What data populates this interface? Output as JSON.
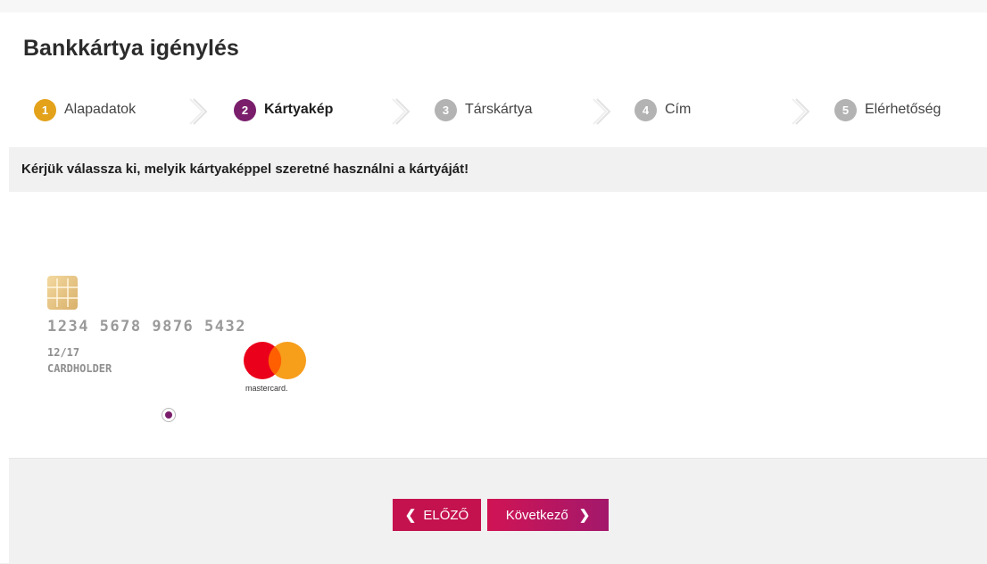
{
  "page": {
    "title": "Bankkártya igénylés",
    "instruction": "Kérjük válassza ki, melyik kártyaképpel szeretné használni a kártyáját!"
  },
  "steps": [
    {
      "number": "1",
      "label": "Alapadatok",
      "state": "done",
      "color": "#e3a21a"
    },
    {
      "number": "2",
      "label": "Kártyakép",
      "state": "active",
      "color": "#7a1e6c"
    },
    {
      "number": "3",
      "label": "Társkártya",
      "state": "pending",
      "color": "#b3b3b3"
    },
    {
      "number": "4",
      "label": "Cím",
      "state": "pending",
      "color": "#b3b3b3"
    },
    {
      "number": "5",
      "label": "Elérhetőség",
      "state": "pending",
      "color": "#b3b3b3"
    }
  ],
  "card": {
    "number": "1234 5678 9876 5432",
    "expiry": "12/17",
    "holder": "CARDHOLDER",
    "brand": "mastercard.",
    "selected": true,
    "icons": [
      "chip-icon",
      "mastercard-logo"
    ]
  },
  "buttons": {
    "prev_label": "ELŐZŐ",
    "next_label": "Következő",
    "prev_icon": "chevron-left-icon",
    "next_icon": "chevron-right-icon"
  },
  "colors": {
    "primary": "#c4124f",
    "active_step": "#7a1e6c",
    "done_step": "#e3a21a",
    "pending_step": "#b3b3b3"
  }
}
